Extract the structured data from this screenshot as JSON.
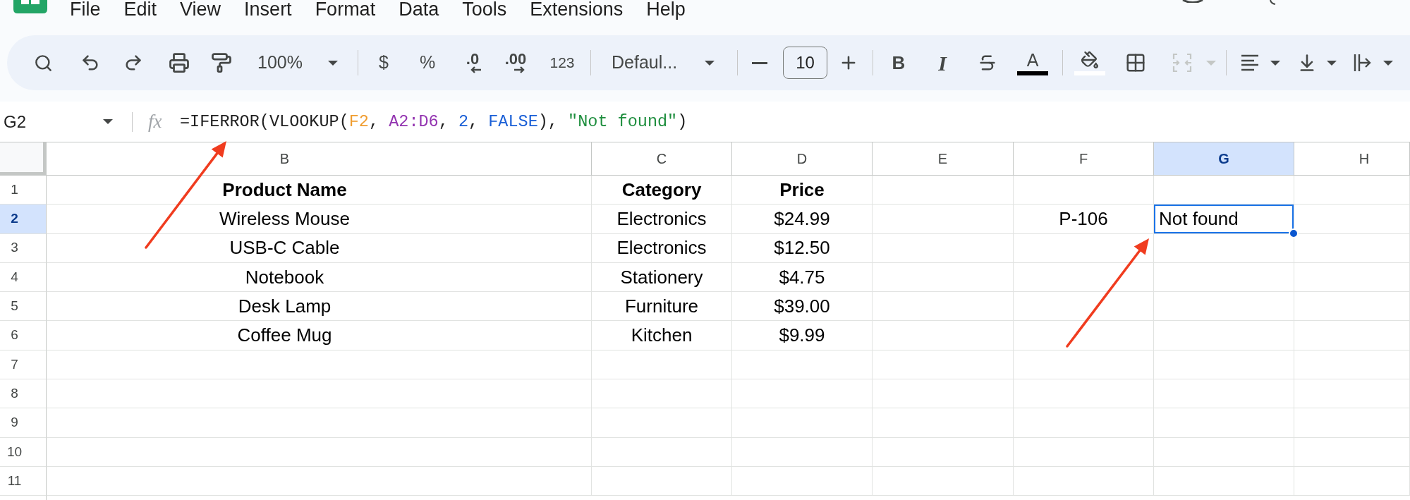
{
  "menu": [
    "File",
    "Edit",
    "View",
    "Insert",
    "Format",
    "Data",
    "Tools",
    "Extensions",
    "Help"
  ],
  "toolbar": {
    "zoom": "100%",
    "currency": "$",
    "percent": "%",
    "decrease_decimal": ".0",
    "increase_decimal": ".00",
    "number_format": "123",
    "font": "Defaul...",
    "font_size": "10",
    "bold": "B",
    "italic": "I",
    "text_color": {
      "label": "A",
      "color": "#000000"
    },
    "fill_color": {
      "color": "#ffffff"
    },
    "merge": {
      "disabled": true
    }
  },
  "formula_bar": {
    "cell_reference": "G2",
    "function_label": "fx",
    "formula": [
      {
        "text": "=IFERROR(VLOOKUP(",
        "color": "#1f1f1f"
      },
      {
        "text": "F2",
        "color": "#f09d30"
      },
      {
        "text": ", ",
        "color": "#1f1f1f"
      },
      {
        "text": "A2:D6",
        "color": "#9334b0"
      },
      {
        "text": ", ",
        "color": "#1f1f1f"
      },
      {
        "text": "2",
        "color": "#1a5fd6"
      },
      {
        "text": ", ",
        "color": "#1f1f1f"
      },
      {
        "text": "FALSE",
        "color": "#1a5fd6"
      },
      {
        "text": "), ",
        "color": "#1f1f1f"
      },
      {
        "text": "\"Not found\"",
        "color": "#1e8e3e"
      },
      {
        "text": ")",
        "color": "#1f1f1f"
      }
    ]
  },
  "sheet": {
    "columns": [
      {
        "label": "B",
        "selected": false
      },
      {
        "label": "C",
        "selected": false
      },
      {
        "label": "D",
        "selected": false
      },
      {
        "label": "E",
        "selected": false
      },
      {
        "label": "F",
        "selected": false
      },
      {
        "label": "G",
        "selected": true
      },
      {
        "label": "H",
        "selected": false
      }
    ],
    "rows": [
      {
        "label": "1",
        "selected": false
      },
      {
        "label": "2",
        "selected": true
      },
      {
        "label": "3",
        "selected": false
      },
      {
        "label": "4",
        "selected": false
      },
      {
        "label": "5",
        "selected": false
      },
      {
        "label": "6",
        "selected": false
      },
      {
        "label": "7",
        "selected": false
      },
      {
        "label": "8",
        "selected": false
      },
      {
        "label": "9",
        "selected": false
      },
      {
        "label": "10",
        "selected": false
      },
      {
        "label": "11",
        "selected": false
      }
    ],
    "data_table": {
      "headers": [
        "Product Name",
        "Category",
        "Price"
      ],
      "records": [
        [
          "Wireless Mouse",
          "Electronics",
          "$24.99"
        ],
        [
          "USB-C Cable",
          "Electronics",
          "$12.50"
        ],
        [
          "Notebook",
          "Stationery",
          "$4.75"
        ],
        [
          "Desk Lamp",
          "Furniture",
          "$39.00"
        ],
        [
          "Coffee Mug",
          "Kitchen",
          "$9.99"
        ]
      ]
    },
    "lookup": {
      "key": "P-106",
      "result": "Not found",
      "selected": true
    }
  },
  "annotations": [
    {
      "kind": "arrow"
    },
    {
      "kind": "arrow"
    }
  ]
}
